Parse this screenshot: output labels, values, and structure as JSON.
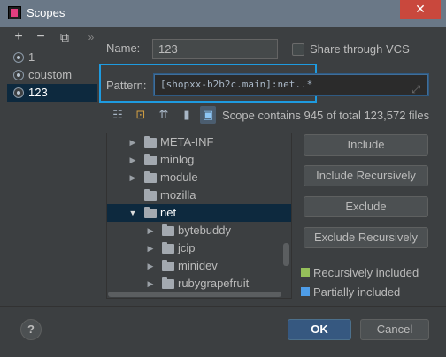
{
  "window": {
    "title": "Scopes",
    "close_glyph": "✕"
  },
  "sidebar": {
    "toolbar": {
      "add": "+",
      "remove": "−",
      "copy": "⧉",
      "more": "»"
    },
    "items": [
      {
        "label": "1",
        "selected": false
      },
      {
        "label": "coustom",
        "selected": false
      },
      {
        "label": "123",
        "selected": true
      }
    ]
  },
  "form": {
    "name_label": "Name:",
    "name_value": "123",
    "share_label": "Share through VCS",
    "pattern_label": "Pattern:",
    "pattern_value": "[shopxx-b2b2c.main]:net..*"
  },
  "tree_toolbar": {
    "icons": [
      "hierarchy-icon",
      "module-icon",
      "flatten-icon",
      "package-icon",
      "filter-icon"
    ],
    "scope_info": "Scope contains 945 of total 123,572 files"
  },
  "tree": {
    "rows": [
      {
        "label": "META-INF",
        "expanded": false,
        "depth": 0,
        "selected": false,
        "has_arrow": true
      },
      {
        "label": "minlog",
        "expanded": false,
        "depth": 0,
        "selected": false,
        "has_arrow": true
      },
      {
        "label": "module",
        "expanded": false,
        "depth": 0,
        "selected": false,
        "has_arrow": true
      },
      {
        "label": "mozilla",
        "expanded": false,
        "depth": 0,
        "selected": false,
        "has_arrow": false
      },
      {
        "label": "net",
        "expanded": true,
        "depth": 0,
        "selected": true,
        "has_arrow": true
      },
      {
        "label": "bytebuddy",
        "expanded": false,
        "depth": 1,
        "selected": false,
        "has_arrow": true
      },
      {
        "label": "jcip",
        "expanded": false,
        "depth": 1,
        "selected": false,
        "has_arrow": true
      },
      {
        "label": "minidev",
        "expanded": false,
        "depth": 1,
        "selected": false,
        "has_arrow": true
      },
      {
        "label": "rubygrapefruit",
        "expanded": false,
        "depth": 1,
        "selected": false,
        "has_arrow": true
      }
    ]
  },
  "buttons": {
    "include": "Include",
    "include_recursively": "Include Recursively",
    "exclude": "Exclude",
    "exclude_recursively": "Exclude Recursively"
  },
  "legend": {
    "recursively_included": {
      "label": "Recursively included",
      "color": "#95c05a"
    },
    "partially_included": {
      "label": "Partially included",
      "color": "#4e9de8"
    }
  },
  "footer": {
    "help": "?",
    "ok": "OK",
    "cancel": "Cancel"
  },
  "colors": {
    "accent": "#1e9be0",
    "selection": "#0d293e",
    "ok_button": "#365880",
    "close_button": "#c9483d"
  }
}
